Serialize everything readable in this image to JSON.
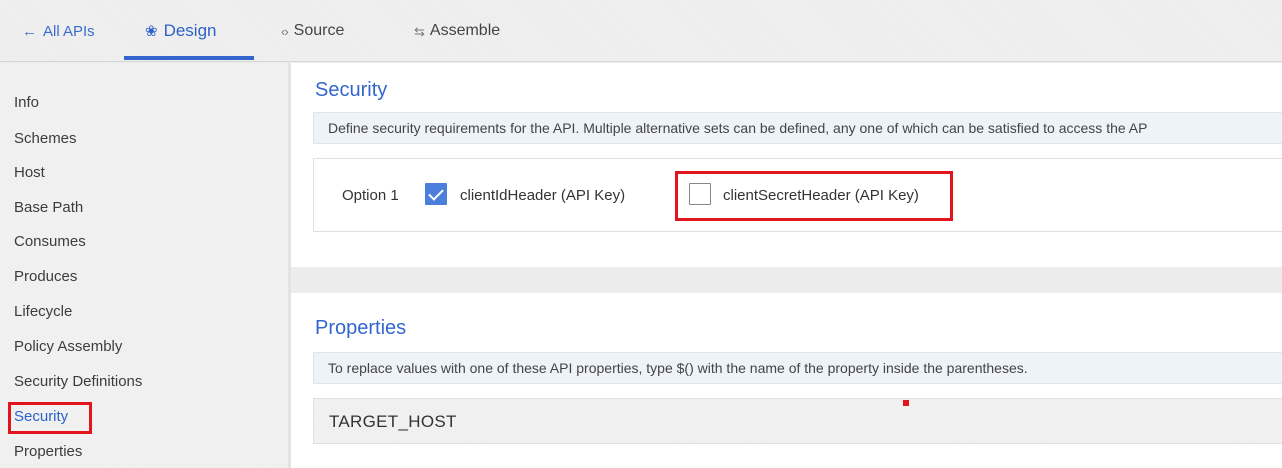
{
  "nav": {
    "back_label": "All APIs",
    "back_icon": "arrow-left-icon",
    "tabs": [
      {
        "label": "Design",
        "icon": "palette-icon",
        "active": true
      },
      {
        "label": "Source",
        "icon": "code-brackets-icon",
        "active": false
      },
      {
        "label": "Assemble",
        "icon": "assemble-icon",
        "active": false
      }
    ]
  },
  "sidebar": {
    "items": [
      {
        "label": "Info"
      },
      {
        "label": "Schemes"
      },
      {
        "label": "Host"
      },
      {
        "label": "Base Path"
      },
      {
        "label": "Consumes"
      },
      {
        "label": "Produces"
      },
      {
        "label": "Lifecycle"
      },
      {
        "label": "Policy Assembly"
      },
      {
        "label": "Security Definitions"
      },
      {
        "label": "Security",
        "active": true
      },
      {
        "label": "Properties"
      }
    ]
  },
  "security": {
    "title": "Security",
    "description": "Define security requirements for the API. Multiple alternative sets can be defined, any one of which can be satisfied to access the AP",
    "option_label": "Option 1",
    "checkboxes": [
      {
        "label": "clientIdHeader (API Key)",
        "checked": true
      },
      {
        "label": "clientSecretHeader (API Key)",
        "checked": false
      }
    ]
  },
  "properties": {
    "title": "Properties",
    "description": "To replace values with one of these API properties, type $() with the name of the property inside the parentheses.",
    "items": [
      {
        "name": "TARGET_HOST"
      }
    ]
  },
  "colors": {
    "accent": "#3366cc",
    "highlight": "#e2151d",
    "checkbox_checked": "#4c7fdc"
  }
}
